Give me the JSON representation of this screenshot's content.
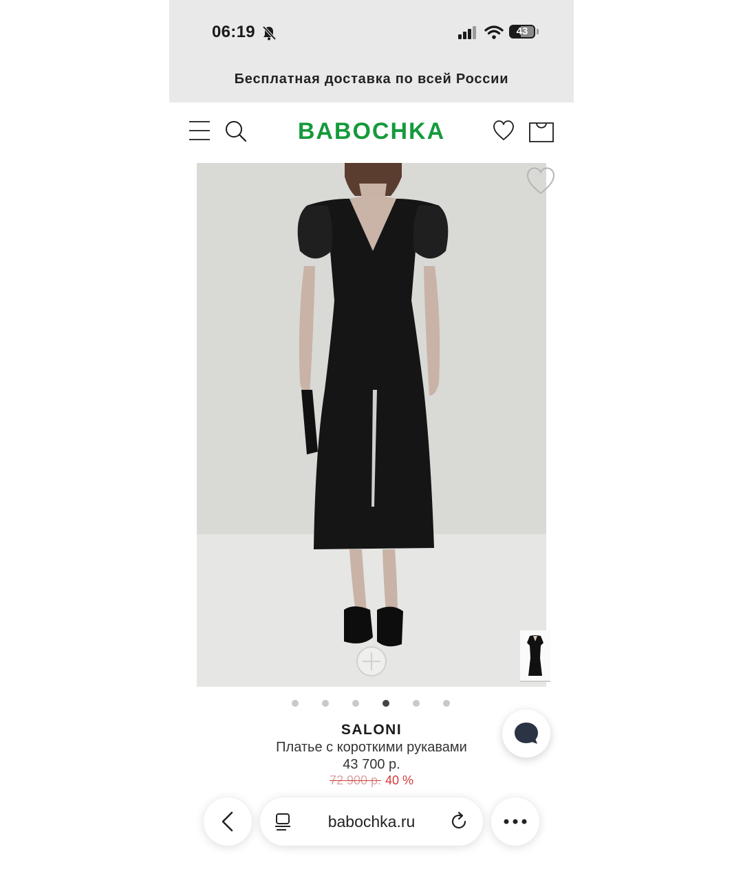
{
  "status_bar": {
    "time": "06:19",
    "battery": "43",
    "icons": [
      "bell-slash-icon",
      "signal-icon",
      "wifi-icon",
      "battery-icon"
    ]
  },
  "promo_bar": {
    "text": "Бесплатная доставка по всей России"
  },
  "header": {
    "logo": "BABOCHKA",
    "icons": [
      "menu-icon",
      "search-icon",
      "heart-icon",
      "bag-icon"
    ],
    "logo_color": "#159a3c"
  },
  "gallery": {
    "slide_count": 6,
    "active_slide": 4,
    "icons": [
      "favorite-heart-icon",
      "zoom-plus-icon"
    ]
  },
  "product": {
    "brand": "SALONI",
    "name": "Платье с короткими рукавами",
    "price": "43 700 р.",
    "old_price": "72 900 р.",
    "discount": "40 %",
    "discount_color": "#d23a3a"
  },
  "browser": {
    "url": "babochka.ru",
    "icons": [
      "back-chevron-icon",
      "reader-icon",
      "reload-icon",
      "more-dots-icon"
    ]
  }
}
